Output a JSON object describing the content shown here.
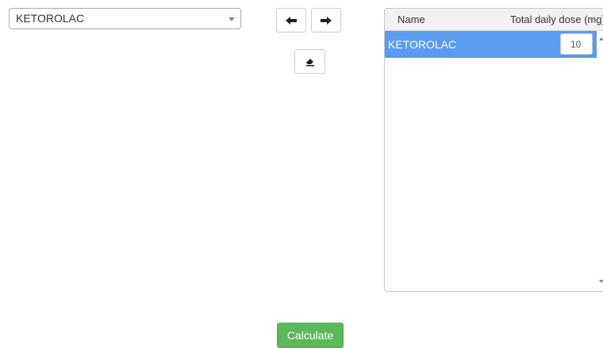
{
  "drug_select": {
    "selected": "KETOROLAC"
  },
  "icons": {
    "move_left": "arrow-left-icon",
    "move_right": "arrow-right-icon",
    "clear": "eraser-icon"
  },
  "table": {
    "headers": {
      "name": "Name",
      "dose": "Total daily dose (mg)"
    },
    "rows": [
      {
        "name": "KETOROLAC",
        "dose": "10"
      }
    ]
  },
  "calculate_label": "Calculate",
  "colors": {
    "selected_row": "#5b9bf0",
    "calculate_button": "#5cb85c"
  }
}
